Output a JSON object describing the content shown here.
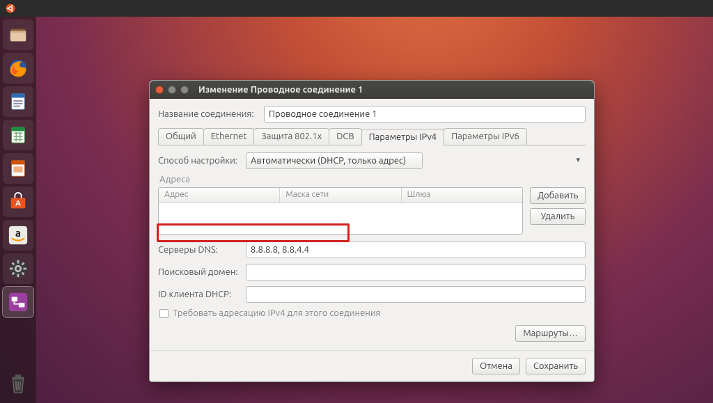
{
  "launcher": {
    "items": [
      {
        "name": "files-icon"
      },
      {
        "name": "firefox-icon"
      },
      {
        "name": "writer-icon"
      },
      {
        "name": "calc-icon"
      },
      {
        "name": "impress-icon"
      },
      {
        "name": "software-center-icon"
      },
      {
        "name": "amazon-icon"
      },
      {
        "name": "settings-icon"
      },
      {
        "name": "network-manager-icon"
      }
    ]
  },
  "dialog": {
    "title": "Изменение Проводное соединение 1",
    "connection_name_label": "Название соединения:",
    "connection_name_value": "Проводное соединение 1",
    "tabs": [
      "Общий",
      "Ethernet",
      "Защита 802.1x",
      "DCB",
      "Параметры IPv4",
      "Параметры IPv6"
    ],
    "active_tab_index": 4,
    "method_label": "Способ настройки:",
    "method_value": "Автоматически (DHCP, только адрес)",
    "addresses_label": "Адреса",
    "addr_cols": [
      "Адрес",
      "Маска сети",
      "Шлюз"
    ],
    "add_btn": "Добавить",
    "del_btn": "Удалить",
    "dns_label": "Серверы DNS:",
    "dns_value": "8.8.8.8, 8.8.4.4",
    "search_label": "Поисковый домен:",
    "search_value": "",
    "dhcp_id_label": "ID клиента DHCP:",
    "dhcp_id_value": "",
    "require_ipv4_label": "Требовать адресацию IPv4 для этого соединения",
    "routes_btn": "Маршруты…",
    "cancel_btn": "Отмена",
    "save_btn": "Сохранить"
  }
}
